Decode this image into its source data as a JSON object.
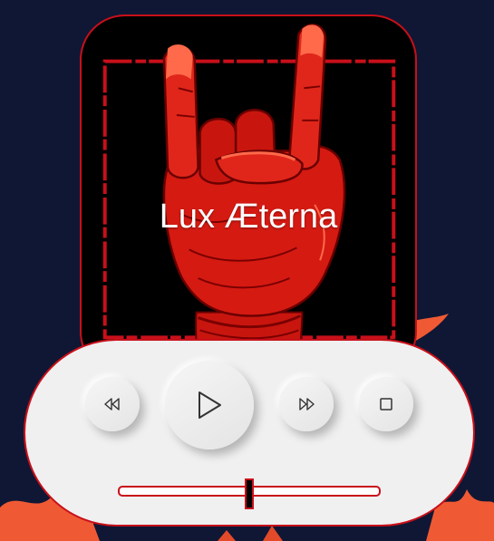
{
  "player": {
    "track_title": "Lux Æterna",
    "progress": 0.5
  },
  "controls": {
    "rewind": {
      "icon": "rewind-icon"
    },
    "play": {
      "icon": "play-icon"
    },
    "forward": {
      "icon": "fast-forward-icon"
    },
    "stop": {
      "icon": "stop-icon"
    }
  },
  "colors": {
    "background": "#0f1734",
    "accent": "#c8101a",
    "panel": "#f0f0f0",
    "card": "#000000",
    "flame": "#ef5a34"
  }
}
